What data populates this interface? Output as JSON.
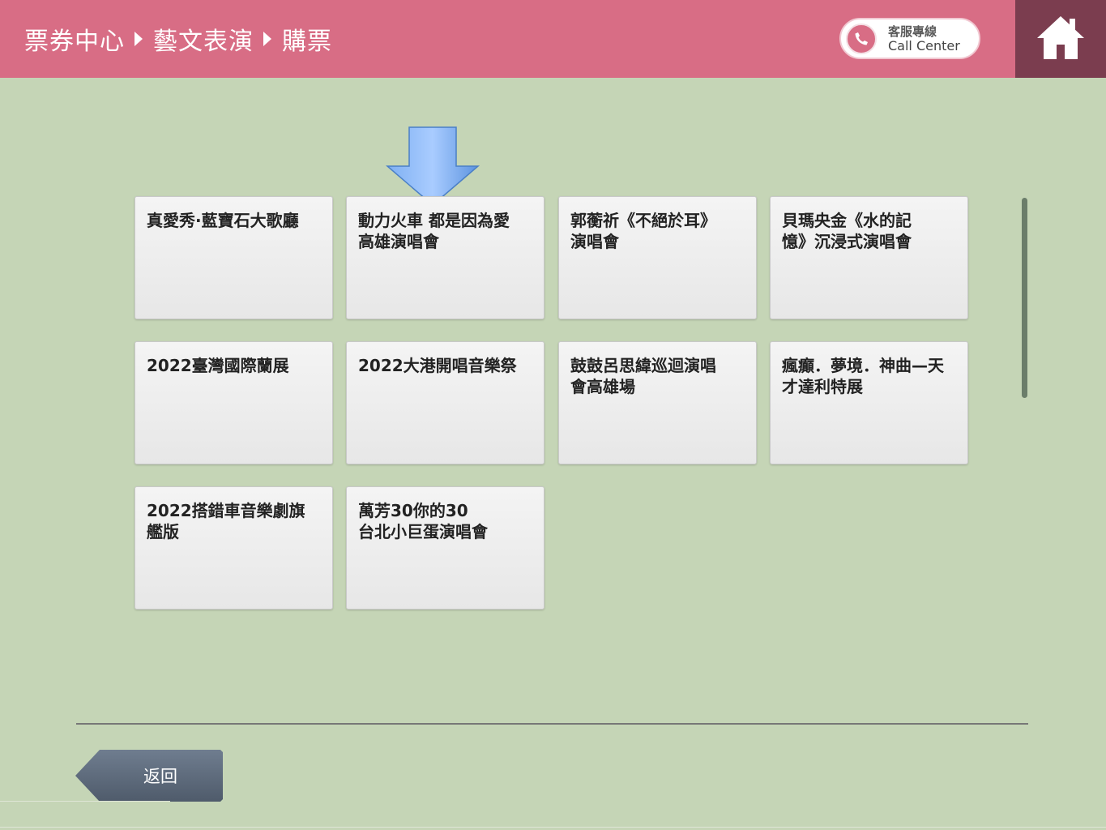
{
  "header": {
    "breadcrumb": [
      "票券中心",
      "藝文表演",
      "購票"
    ],
    "call_center": {
      "label_zh": "客服專線",
      "label_en": "Call Center"
    },
    "colors": {
      "bar": "#d86d85",
      "home": "#7b3d4f"
    }
  },
  "events": [
    {
      "lines": [
        "真愛秀·藍寶石大歌廳"
      ]
    },
    {
      "lines": [
        "動力火車 都是因為愛",
        "高雄演唱會"
      ]
    },
    {
      "lines": [
        "郭蘅祈《不絕於耳》",
        "演唱會"
      ]
    },
    {
      "lines": [
        "貝瑪央金《水的記",
        "憶》沉浸式演唱會"
      ]
    },
    {
      "lines": [
        "2022臺灣國際蘭展"
      ]
    },
    {
      "lines": [
        "2022大港開唱音樂祭"
      ]
    },
    {
      "lines": [
        "鼓鼓呂思緯巡迴演唱",
        "會高雄場"
      ]
    },
    {
      "lines": [
        "瘋癲．夢境．神曲—天",
        "才達利特展"
      ]
    },
    {
      "lines": [
        "2022搭錯車音樂劇旗",
        "艦版"
      ]
    },
    {
      "lines": [
        "萬芳30你的30",
        "台北小巨蛋演唱會"
      ]
    }
  ],
  "footer": {
    "back_label": "返回"
  },
  "icons": {
    "home": "home-icon",
    "phone": "phone-icon",
    "pointer": "arrow-down-icon",
    "back": "back-arrow-icon"
  }
}
